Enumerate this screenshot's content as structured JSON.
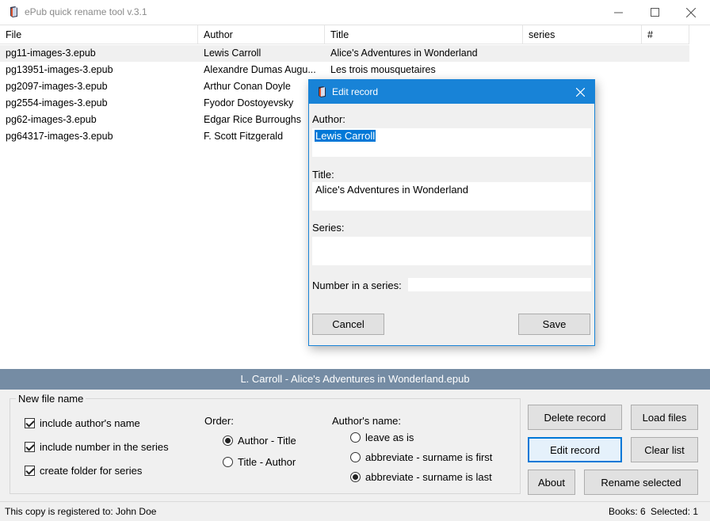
{
  "window": {
    "title": "ePub quick rename tool v.3.1"
  },
  "columns": {
    "file": "File",
    "author": "Author",
    "title": "Title",
    "series": "series",
    "number": "#"
  },
  "rows": [
    {
      "file": "pg11-images-3.epub",
      "author": "Lewis Carroll",
      "title": "Alice's Adventures in Wonderland"
    },
    {
      "file": "pg13951-images-3.epub",
      "author": "Alexandre Dumas Augu...",
      "title": "Les trois mousquetaires"
    },
    {
      "file": "pg2097-images-3.epub",
      "author": "Arthur Conan Doyle",
      "title": ""
    },
    {
      "file": "pg2554-images-3.epub",
      "author": "Fyodor Dostoyevsky",
      "title": ""
    },
    {
      "file": "pg62-images-3.epub",
      "author": "Edgar Rice Burroughs",
      "title": ""
    },
    {
      "file": "pg64317-images-3.epub",
      "author": "F. Scott Fitzgerald",
      "title": ""
    }
  ],
  "preview_filename": "L. Carroll - Alice's Adventures in Wonderland.epub",
  "options": {
    "group_title": "New file name",
    "include_author": "include author's name",
    "include_number": "include number in the series",
    "create_folder": "create folder for series",
    "order_label": "Order:",
    "order_author_title": "Author - Title",
    "order_title_author": "Title - Author",
    "authors_name_label": "Author's name:",
    "leave_as_is": "leave as is",
    "abbrev_first": "abbreviate - surname is first",
    "abbrev_last": "abbreviate - surname is last"
  },
  "buttons": {
    "delete_record": "Delete record",
    "load_files": "Load files",
    "edit_record": "Edit record",
    "clear_list": "Clear list",
    "about": "About",
    "rename_selected": "Rename selected"
  },
  "statusbar": {
    "registered": "This copy is registered to: John Doe",
    "books": "Books: 6",
    "selected": "Selected: 1"
  },
  "dialog": {
    "title": "Edit record",
    "author_label": "Author:",
    "author_value": "Lewis Carroll",
    "title_label": "Title:",
    "title_value": "Alice's Adventures in Wonderland",
    "series_label": "Series:",
    "series_value": "",
    "number_label": "Number in a series:",
    "number_value": "",
    "cancel": "Cancel",
    "save": "Save"
  },
  "colors": {
    "accent": "#1883d7",
    "preview_strip": "#758ca4",
    "selection": "#0078d7"
  },
  "icons": {
    "app": "epub-app-icon",
    "close": "close-icon",
    "minimize": "minimize-icon",
    "maximize": "maximize-icon"
  }
}
